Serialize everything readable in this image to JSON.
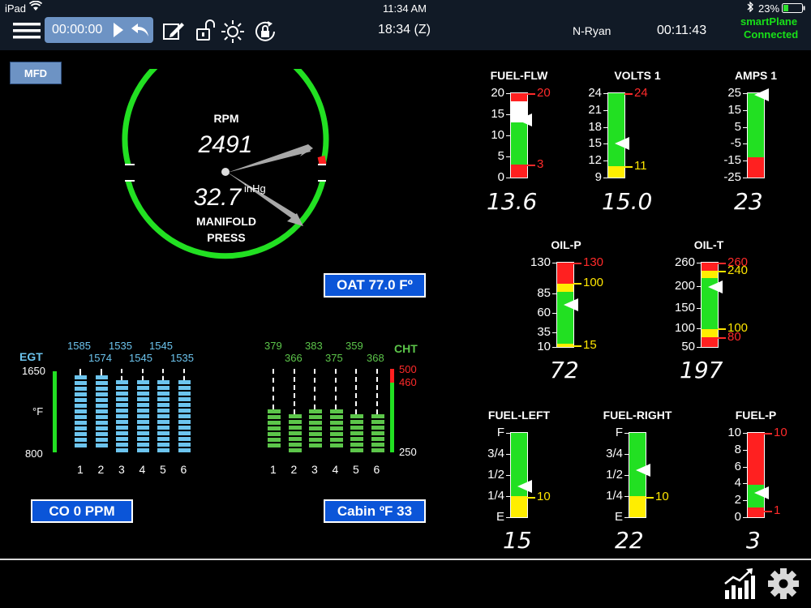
{
  "status_bar": {
    "device": "iPad",
    "time": "11:34 AM",
    "battery": "23%"
  },
  "toolbar": {
    "timer": "00:00:00",
    "zulu_time": "18:34 (Z)",
    "pilot": "N-Ryan",
    "flight_time": "00:11:43",
    "connection_line1": "smartPlane",
    "connection_line2": "Connected"
  },
  "mode_button": "MFD",
  "rpm_gauge": {
    "rpm_label": "RPM",
    "rpm_value": "2491",
    "map_value": "32.7",
    "map_unit": "inHg",
    "map_label_line1": "MANIFOLD",
    "map_label_line2": "PRESS"
  },
  "oat_button": "OAT 77.0 Fº",
  "co_button": "CO 0 PPM",
  "cabin_button": "Cabin ºF 33",
  "egt": {
    "label": "EGT",
    "unit": "°F",
    "max_label": "1650",
    "min_label": "800",
    "cylinders": [
      "1",
      "2",
      "3",
      "4",
      "5",
      "6"
    ],
    "values_top": [
      "1585",
      "1535",
      "1545"
    ],
    "values_bottom": [
      "1574",
      "1545",
      "1535"
    ]
  },
  "cht": {
    "label": "CHT",
    "red_high": "500",
    "red_low": "460",
    "min_label": "250",
    "cylinders": [
      "1",
      "2",
      "3",
      "4",
      "5",
      "6"
    ],
    "values_top": [
      "379",
      "383",
      "359"
    ],
    "values_bottom": [
      "366",
      "375",
      "368"
    ]
  },
  "gauges": [
    {
      "id": "fuel-flw",
      "title": "FUEL-FLW",
      "ticks": [
        "20",
        "15",
        "10",
        "5",
        "0"
      ],
      "marks": [
        {
          "text": "20",
          "color": "#ff2a2a"
        },
        {
          "text": "3",
          "color": "#ff2a2a"
        }
      ],
      "value": "13.6"
    },
    {
      "id": "volts",
      "title": "VOLTS 1",
      "ticks": [
        "24",
        "21",
        "18",
        "15",
        "12",
        "9"
      ],
      "marks": [
        {
          "text": "24",
          "color": "#ff2a2a"
        },
        {
          "text": "11",
          "color": "#ffe600"
        }
      ],
      "value": "15.0"
    },
    {
      "id": "amps",
      "title": "AMPS 1",
      "ticks": [
        "25",
        "15",
        "5",
        "-5",
        "-15",
        "-25"
      ],
      "marks": [],
      "value": "23"
    },
    {
      "id": "oil-p",
      "title": "OIL-P",
      "ticks": [
        "130",
        "85",
        "60",
        "35",
        "10"
      ],
      "marks": [
        {
          "text": "130",
          "color": "#ff2a2a"
        },
        {
          "text": "100",
          "color": "#ffe600"
        },
        {
          "text": "15",
          "color": "#ffe600"
        }
      ],
      "value": "72"
    },
    {
      "id": "oil-t",
      "title": "OIL-T",
      "ticks": [
        "260",
        "200",
        "150",
        "100",
        "50"
      ],
      "marks": [
        {
          "text": "260",
          "color": "#ff2a2a"
        },
        {
          "text": "240",
          "color": "#ffe600"
        },
        {
          "text": "100",
          "color": "#ffe600"
        },
        {
          "text": "80",
          "color": "#ff2a2a"
        }
      ],
      "value": "197"
    },
    {
      "id": "fuel-left",
      "title": "FUEL-LEFT",
      "ticks": [
        "F",
        "3/4",
        "1/2",
        "1/4",
        "E"
      ],
      "marks": [
        {
          "text": "10",
          "color": "#ffe600"
        }
      ],
      "value": "15"
    },
    {
      "id": "fuel-right",
      "title": "FUEL-RIGHT",
      "ticks": [
        "F",
        "3/4",
        "1/2",
        "1/4",
        "E"
      ],
      "marks": [
        {
          "text": "10",
          "color": "#ffe600"
        }
      ],
      "value": "22"
    },
    {
      "id": "fuel-p",
      "title": "FUEL-P",
      "ticks": [
        "10",
        "8",
        "6",
        "4",
        "2",
        "0"
      ],
      "marks": [
        {
          "text": "10",
          "color": "#ff2a2a"
        },
        {
          "text": "1",
          "color": "#ff2a2a"
        }
      ],
      "value": "3"
    }
  ],
  "colors": {
    "green": "#22e022",
    "red": "#ff2020",
    "yellow": "#ffee00",
    "egt_blue": "#6cc4ee",
    "cht_green": "#5cc54a",
    "button_blue": "#0b55d8"
  },
  "icons": [
    "menu-icon",
    "play-icon",
    "undo-icon",
    "edit-icon",
    "unlock-icon",
    "brightness-icon",
    "rotation-lock-icon",
    "chart-icon",
    "gear-icon"
  ]
}
